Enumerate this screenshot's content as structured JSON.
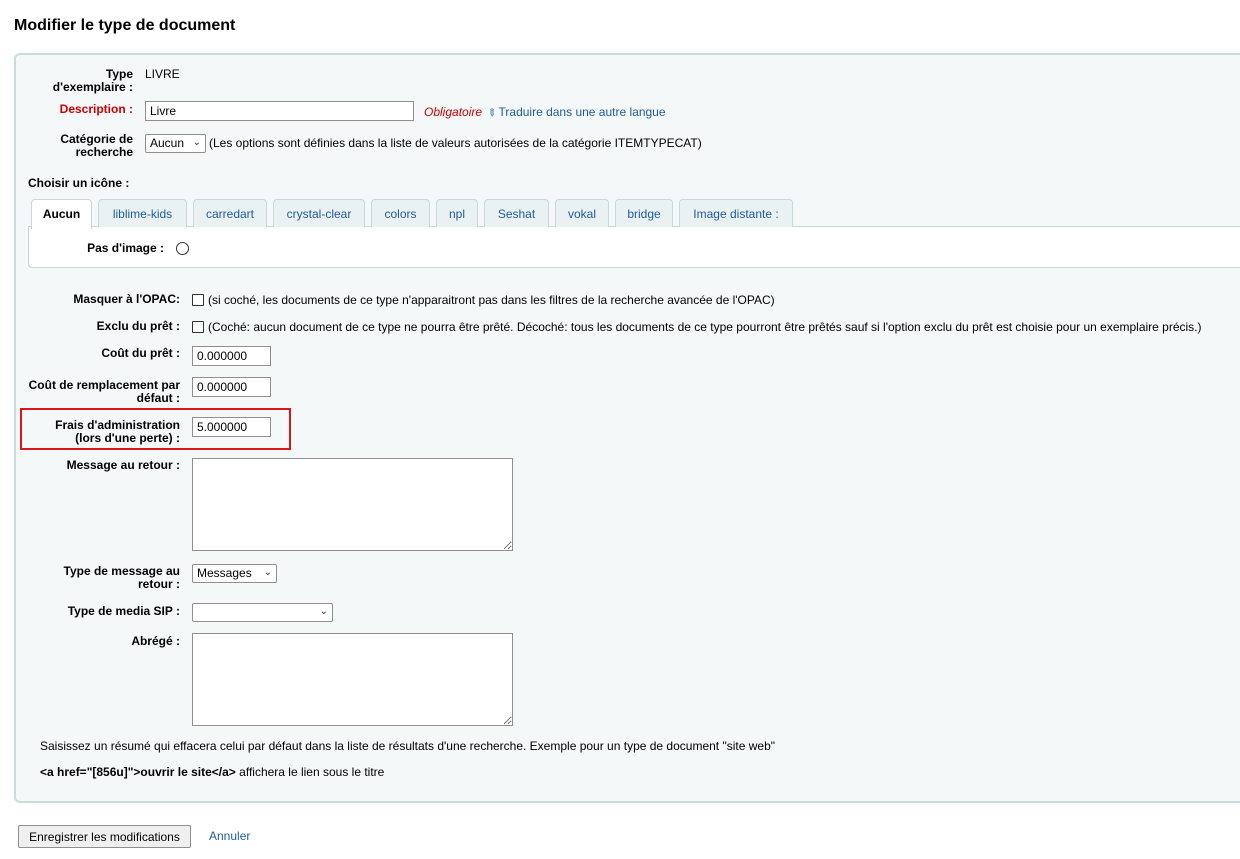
{
  "page_title": "Modifier le type de document",
  "item_type": {
    "label": "Type d'exemplaire :",
    "value": "LIVRE"
  },
  "description": {
    "label": "Description :",
    "value": "Livre",
    "required": "Obligatoire",
    "translate": "Traduire dans une autre langue"
  },
  "search_category": {
    "label": "Catégorie de recherche",
    "selected": "Aucun",
    "hint": "(Les options sont définies dans la liste de valeurs autorisées de la catégorie ITEMTYPECAT)"
  },
  "icon_chooser": {
    "label": "Choisir un icône :",
    "tabs": [
      "Aucun",
      "liblime-kids",
      "carredart",
      "crystal-clear",
      "colors",
      "npl",
      "Seshat",
      "vokal",
      "bridge",
      "Image distante :"
    ],
    "no_image_label": "Pas d'image :"
  },
  "hide_opac": {
    "label": "Masquer à l'OPAC:",
    "hint": "(si coché, les documents de ce type n'apparaitront pas dans les filtres de la recherche avancée de l'OPAC)"
  },
  "not_for_loan": {
    "label": "Exclu du prêt :",
    "hint": "(Coché: aucun document de ce type ne pourra être prêté. Décoché: tous les documents de ce type pourront être prêtés sauf si l'option exclu du prêt est choisie pour un exemplaire précis.)"
  },
  "rental_charge": {
    "label": "Coût du prêt :",
    "value": "0.000000"
  },
  "replacement_price": {
    "label": "Coût de remplacement par défaut :",
    "value": "0.000000"
  },
  "processing_fee": {
    "label": "Frais d'administration (lors d'une perte) :",
    "value": "5.000000"
  },
  "checkin_message": {
    "label": "Message au retour :"
  },
  "checkin_message_type": {
    "label": "Type de message au retour :",
    "selected": "Messages"
  },
  "sip_media_type": {
    "label": "Type de media SIP :",
    "selected": ""
  },
  "summary": {
    "label": "Abrégé :",
    "help1": "Saisissez un résumé qui effacera celui par défaut dans la liste de résultats d'une recherche. Exemple pour un type de document \"site web\"",
    "help2_code": "<a href=\"[856u]\">ouvrir le site</a>",
    "help2_rest": " affichera le lien sous le titre"
  },
  "actions": {
    "save": "Enregistrer les modifications",
    "cancel": "Annuler"
  }
}
